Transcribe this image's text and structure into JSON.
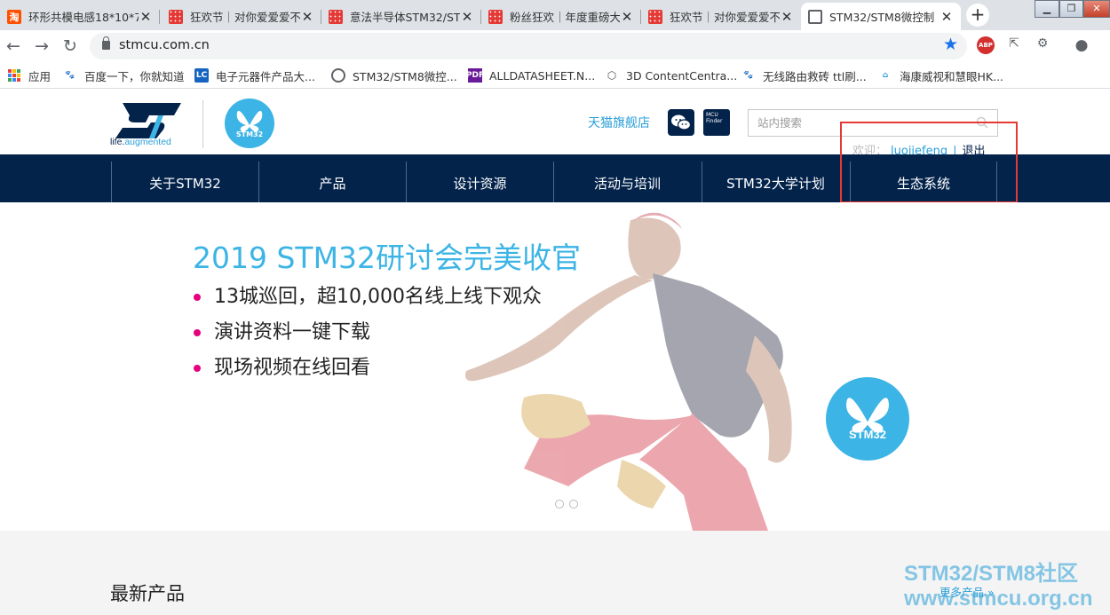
{
  "browser": {
    "tabs": [
      {
        "title": "环形共模电感18*10*7",
        "icon": "taobao",
        "active": false
      },
      {
        "title": "狂欢节｜对你爱爱爱不",
        "icon": "tmall",
        "active": false
      },
      {
        "title": "意法半导体STM32/ST",
        "icon": "tmall",
        "active": false
      },
      {
        "title": "粉丝狂欢｜年度重磅大",
        "icon": "tmall",
        "active": false
      },
      {
        "title": "狂欢节｜对你爱爱爱不",
        "icon": "tmall",
        "active": false
      },
      {
        "title": "STM32/STM8微控制",
        "icon": "globe",
        "active": true
      }
    ],
    "taobao_glyph": "淘",
    "close_glyph": "✕",
    "new_tab_glyph": "+",
    "url": "stmcu.com.cn",
    "abp_label": "ABP",
    "bookmarks": [
      {
        "label": "应用",
        "icon": "apps-grid"
      },
      {
        "label": "百度一下，你就知道",
        "icon": "baidu-paw"
      },
      {
        "label": "电子元器件产品大...",
        "icon": "lc"
      },
      {
        "label": "STM32/STM8微控...",
        "icon": "globe"
      },
      {
        "label": "ALLDATASHEET.N...",
        "icon": "pdf"
      },
      {
        "label": "3D ContentCentra...",
        "icon": "3d"
      },
      {
        "label": "无线路由救砖 ttl刷...",
        "icon": "baidu-paw"
      },
      {
        "label": "海康威视和慧眼HK...",
        "icon": "hik-house"
      }
    ],
    "bookmark_icon_text": {
      "lc": "LC",
      "pdf": "PDF"
    }
  },
  "site": {
    "tagline_prefix": "life.",
    "tagline_suffix": "augmented",
    "badge_label": "STM32",
    "tmall_link": "天猫旗舰店",
    "mcu_finder": "MCU Finder",
    "search_placeholder": "站内搜索",
    "welcome": "欢迎：",
    "username": "luojiefeng",
    "separator": "|",
    "logout": "退出",
    "nav": [
      "关于STM32",
      "产品",
      "设计资源",
      "活动与培训",
      "STM32大学计划",
      "生态系统"
    ],
    "banner": {
      "title": "2019 STM32研讨会完美收官",
      "bullets": [
        "13城巡回，超10,000名线上线下观众",
        "演讲资料一键下载",
        "现场视频在线回看"
      ],
      "badge_label": "STM32"
    },
    "latest_products": "最新产品",
    "more_products": "更多产品 »",
    "watermark_line1": "STM32/STM8社区",
    "watermark_line2": "www.stmcu.org.cn"
  },
  "colors": {
    "st_navy": "#03234b",
    "st_blue": "#3cb4e5",
    "bullet_pink": "#e6007e",
    "highlight_red": "#e53935",
    "bookmark_apps": [
      "#ea4335",
      "#fbbc05",
      "#34a853",
      "#4285f4",
      "#ea4335",
      "#fbbc05",
      "#34a853",
      "#4285f4",
      "#ea4335"
    ]
  }
}
